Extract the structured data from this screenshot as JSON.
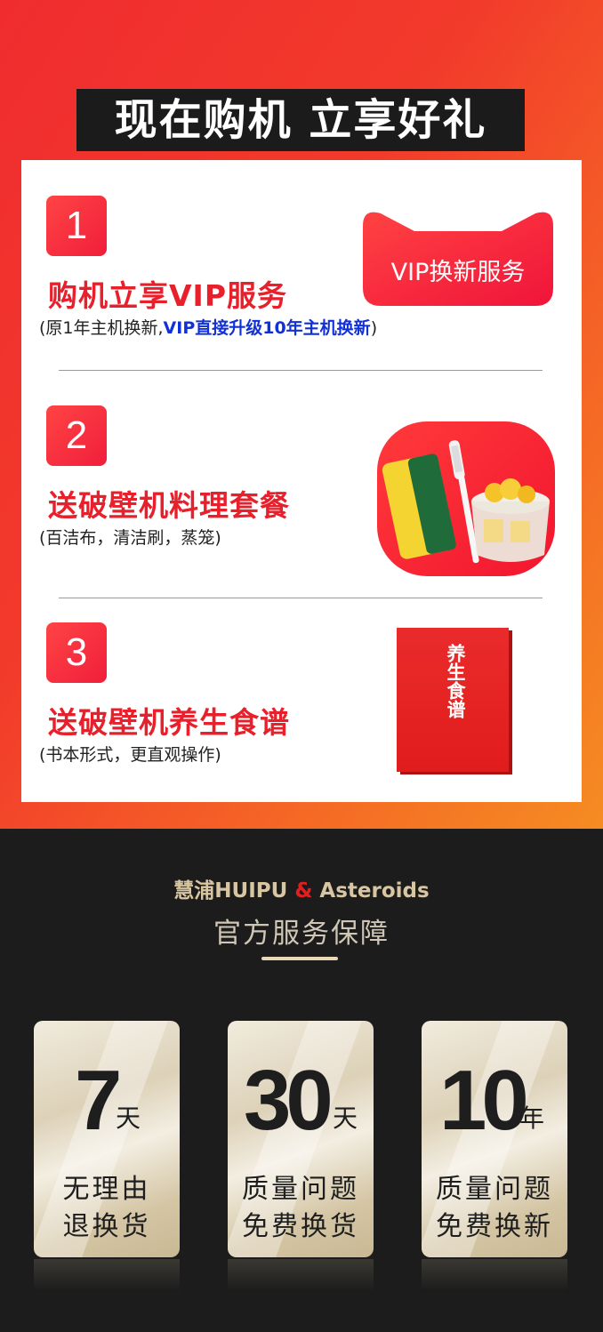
{
  "banner": "现在购机 立享好礼",
  "offers": [
    {
      "num": "1",
      "title": "购机立享VIP服务",
      "sub_prefix": "(原1年主机换新,",
      "sub_highlight": "VIP直接升级10年主机换新",
      "sub_suffix": ")",
      "badge": "VIP换新服务"
    },
    {
      "num": "2",
      "title": "送破壁机料理套餐",
      "sub": "(百洁布，清洁刷，蒸笼)"
    },
    {
      "num": "3",
      "title": "送破壁机养生食谱",
      "sub": "(书本形式，更直观操作)",
      "book_title": "养生食谱"
    }
  ],
  "brand": {
    "left": "慧浦HUIPU",
    "amp": "&",
    "right": "Asteroids"
  },
  "guarantee_title": "官方服务保障",
  "cards": [
    {
      "big": "7",
      "unit": "天",
      "line1": "无理由",
      "line2": "退换货"
    },
    {
      "big": "30",
      "unit": "天",
      "line1": "质量问题",
      "line2": "免费换货"
    },
    {
      "big": "10",
      "unit": "年",
      "line1": "质量问题",
      "line2": "免费换新"
    }
  ],
  "colors": {
    "accent_red": "#e8202c",
    "highlight_blue": "#1030d8",
    "gold": "#d8c6a2",
    "dark_bg": "#1c1c1c"
  }
}
